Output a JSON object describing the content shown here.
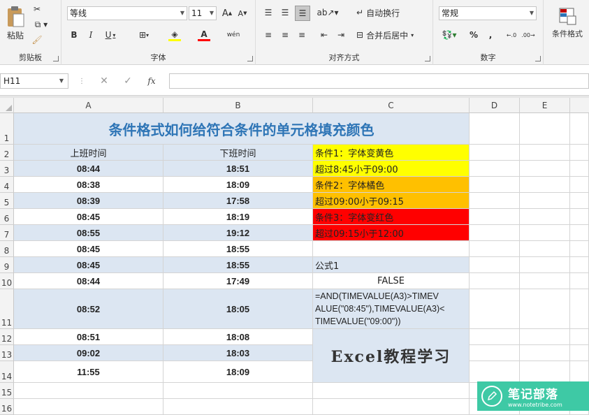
{
  "ribbon": {
    "clipboard": {
      "label": "剪贴板",
      "paste": "粘贴"
    },
    "font": {
      "label": "字体",
      "name": "等线",
      "size": "11",
      "bold": "B",
      "italic": "I",
      "underline": "U",
      "grow": "A",
      "shrink": "A",
      "font_color_letter": "A",
      "phonetic": "wén"
    },
    "alignment": {
      "label": "对齐方式",
      "wrap": "自动换行",
      "merge": "合并后居中"
    },
    "number": {
      "label": "数字",
      "format": "常规",
      "percent": "%",
      "comma": ","
    },
    "styles": {
      "conditional": "条件格式"
    }
  },
  "formula_bar": {
    "cell_ref": "H11",
    "fx": "fx",
    "content": ""
  },
  "columns": [
    "A",
    "B",
    "C",
    "D",
    "E"
  ],
  "rows": [
    "1",
    "2",
    "3",
    "4",
    "5",
    "6",
    "7",
    "8",
    "9",
    "10",
    "11",
    "12",
    "13",
    "14",
    "15",
    "16"
  ],
  "sheet": {
    "title": "条件格式如何给符合条件的单元格填充颜色",
    "header_a": "上班时间",
    "header_b": "下班时间",
    "times": [
      [
        "08:44",
        "18:51"
      ],
      [
        "08:38",
        "18:09"
      ],
      [
        "08:39",
        "17:58"
      ],
      [
        "08:45",
        "18:19"
      ],
      [
        "08:55",
        "19:12"
      ],
      [
        "08:45",
        "18:55"
      ],
      [
        "08:45",
        "18:55"
      ],
      [
        "08:44",
        "17:49"
      ],
      [
        "08:52",
        "18:05"
      ],
      [
        "08:51",
        "18:08"
      ],
      [
        "09:02",
        "18:03"
      ],
      [
        "11:55",
        "18:09"
      ]
    ],
    "conditions": [
      {
        "text": "条件1：字体变黄色",
        "color": "#ffff00"
      },
      {
        "text": "超过8:45小于09:00",
        "color": "#ffff00"
      },
      {
        "text": "条件2：字体橘色",
        "color": "#ffc000"
      },
      {
        "text": "超过09:00小于09:15",
        "color": "#ffc000"
      },
      {
        "text": "条件3：字体变红色",
        "color": "#ff0000"
      },
      {
        "text": "超过09:15小于12:00",
        "color": "#ff0000"
      }
    ],
    "formula_label": "公式1",
    "false_value": "FALSE",
    "formula_lines": [
      "=AND(TIMEVALUE(A3)>TIMEV",
      "ALUE(\"08:45\"),TIMEVALUE(A3)<",
      "TIMEVALUE(\"09:00\"))"
    ],
    "banner": "Excel教程学习"
  },
  "watermark": {
    "name": "笔记部落",
    "url": "www.notetribe.com"
  },
  "colors": {
    "title_blue": "#2e75b6",
    "band_blue": "#dce6f2",
    "grid": "#d4d4d4",
    "watermark_green": "#3ec9a5"
  }
}
